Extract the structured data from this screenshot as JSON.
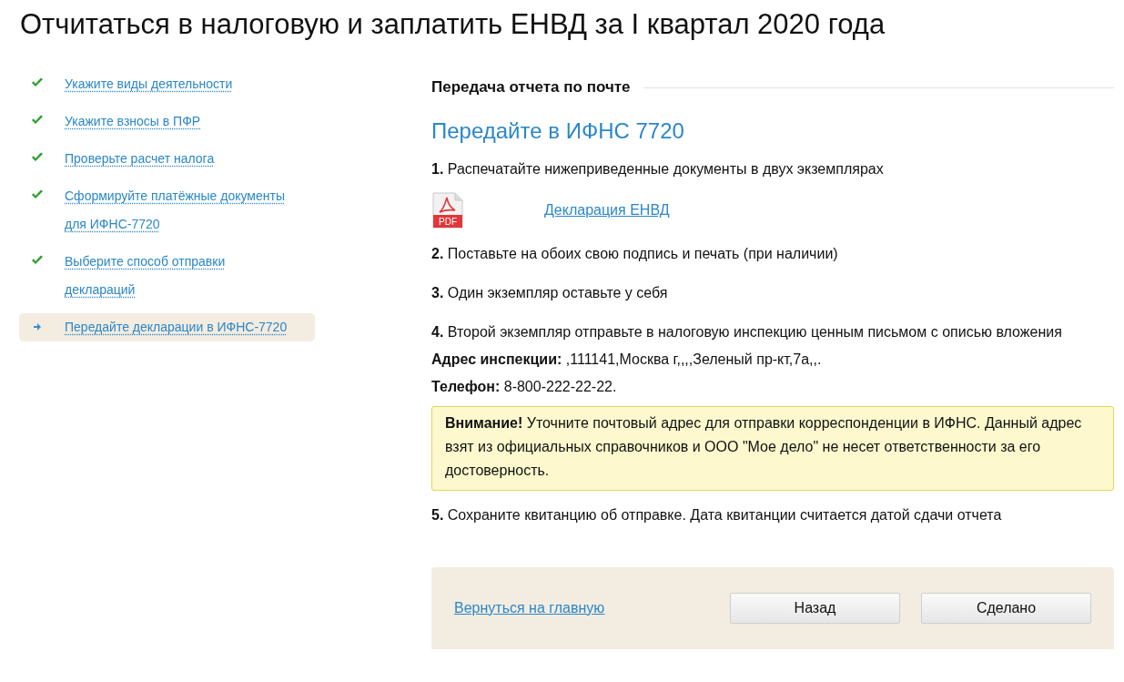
{
  "page_title": "Отчитаться в налоговую и заплатить ЕНВД за I квартал 2020 года",
  "steps": [
    {
      "label": "Укажите виды деятельности",
      "done": true,
      "selected": false
    },
    {
      "label": "Укажите взносы в ПФР",
      "done": true,
      "selected": false
    },
    {
      "label": "Проверьте расчет налога",
      "done": true,
      "selected": false
    },
    {
      "label": "Сформируйте платёжные документы для ИФНС-7720",
      "done": true,
      "selected": false
    },
    {
      "label": "Выберите способ отправки деклараций",
      "done": true,
      "selected": false
    },
    {
      "label": "Передайте декларации в ИФНС-7720",
      "done": false,
      "selected": true
    }
  ],
  "section_heading": "Передача отчета по почте",
  "title": "Передайте в ИФНС 7720",
  "blocks": [
    {
      "kind": "step",
      "text": "**1.** Распечатайте нижеприведенные документы в двух экземплярах"
    },
    {
      "kind": "document",
      "icon_text": "PDF",
      "link": "Декларация ЕНВД"
    },
    {
      "kind": "step",
      "text": "**2.** Поставьте на обоих свою подпись и печать (при наличии)"
    },
    {
      "kind": "step",
      "text": "**3.** Один экземпляр оставьте у себя"
    },
    {
      "kind": "step",
      "text": "**4.** Второй экземпляр отправьте в налоговую инспекцию ценным письмом с описью вложения"
    },
    {
      "kind": "info",
      "text": "**Адрес инспекции:** ,111141,Москва г,,,,Зеленый пр-кт,7а,,."
    },
    {
      "kind": "info",
      "text": "**Телефон:** 8-800-222-22-22."
    },
    {
      "kind": "alert",
      "text": "**Внимание!** Уточните почтовый адрес для отправки корреспонденции в ИФНС. Данный адрес взят из официальных справочников и ООО \"Мое дело\" не несет ответственности за его достоверность."
    },
    {
      "kind": "step",
      "text": "**5.** Сохраните квитанцию об отправке. Дата квитанции считается датой сдачи отчета"
    }
  ],
  "footer": {
    "link": "Вернуться на главную",
    "buttons": [
      "Назад",
      "Сделано"
    ]
  }
}
